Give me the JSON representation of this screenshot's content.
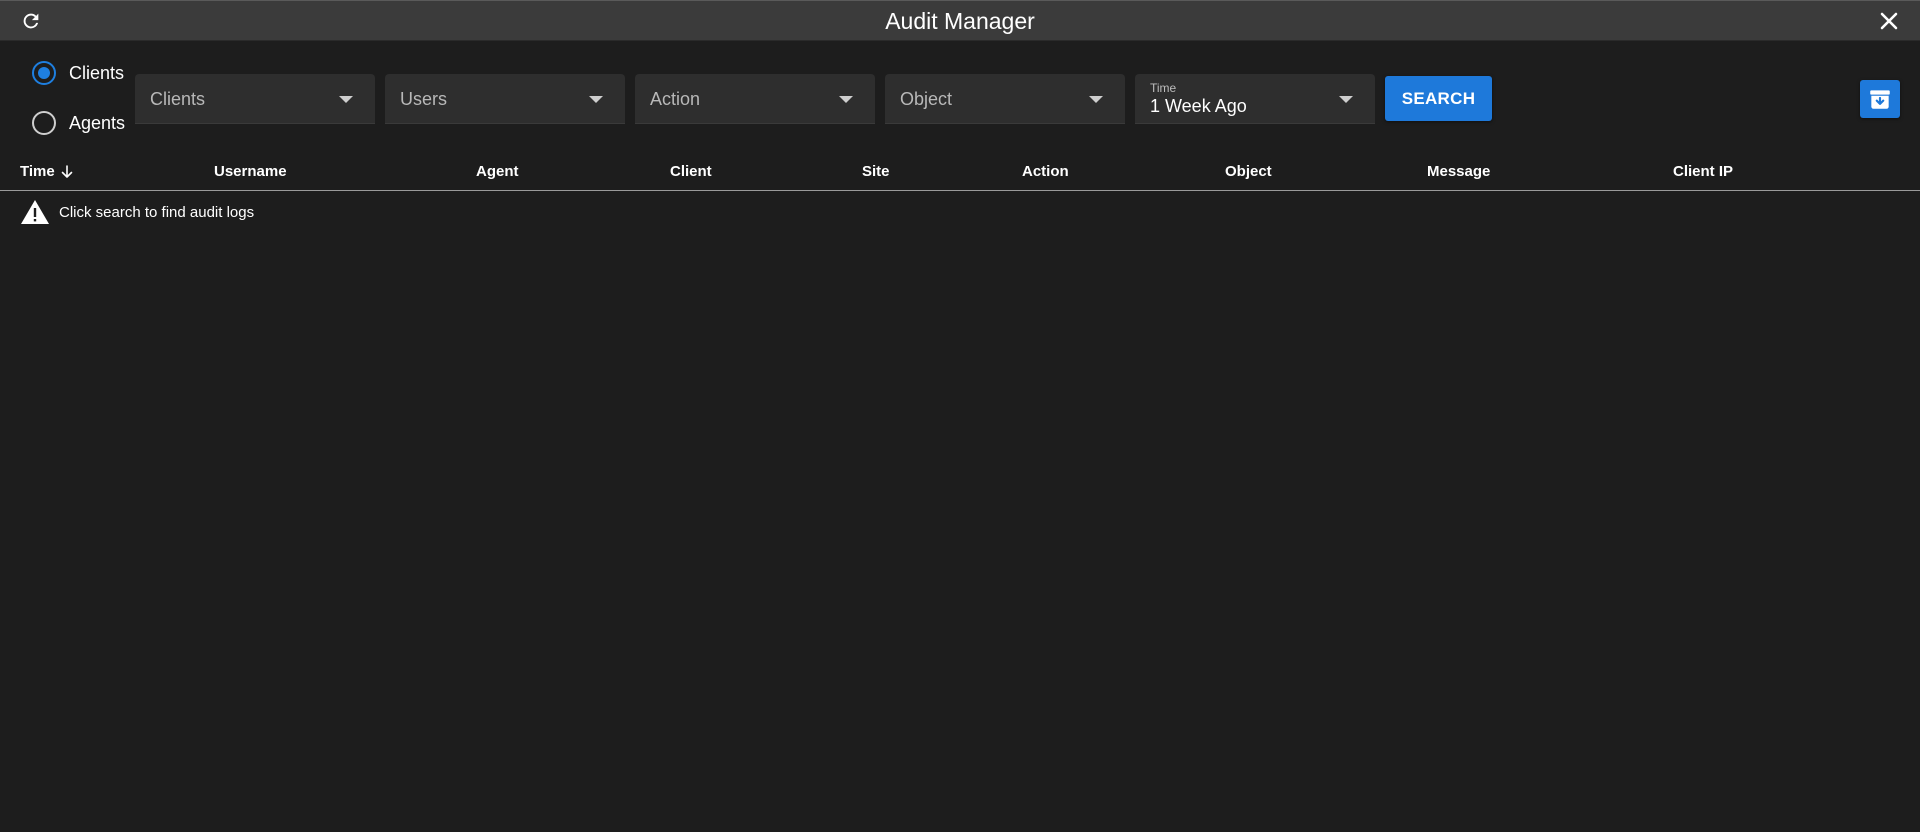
{
  "window": {
    "title": "Audit Manager",
    "refresh_icon": "refresh-icon",
    "close_icon": "close-icon"
  },
  "filters": {
    "mode_options": [
      {
        "label": "Clients",
        "checked": true
      },
      {
        "label": "Agents",
        "checked": false
      }
    ],
    "clients_placeholder": "Clients",
    "users_placeholder": "Users",
    "action_placeholder": "Action",
    "object_placeholder": "Object",
    "time": {
      "label": "Time",
      "value": "1 Week Ago"
    },
    "search_label": "SEARCH",
    "archive_icon": "archive-download-icon"
  },
  "table": {
    "columns": [
      "Time",
      "Username",
      "Agent",
      "Client",
      "Site",
      "Action",
      "Object",
      "Message",
      "Client IP"
    ],
    "sort_column": "Time",
    "sort_direction": "descending",
    "empty_message": "Click search to find audit logs"
  },
  "colors": {
    "accent": "#1e79da",
    "background": "#1d1d1d",
    "titlebar": "#3b3b3b",
    "field": "#2e2e2e"
  }
}
